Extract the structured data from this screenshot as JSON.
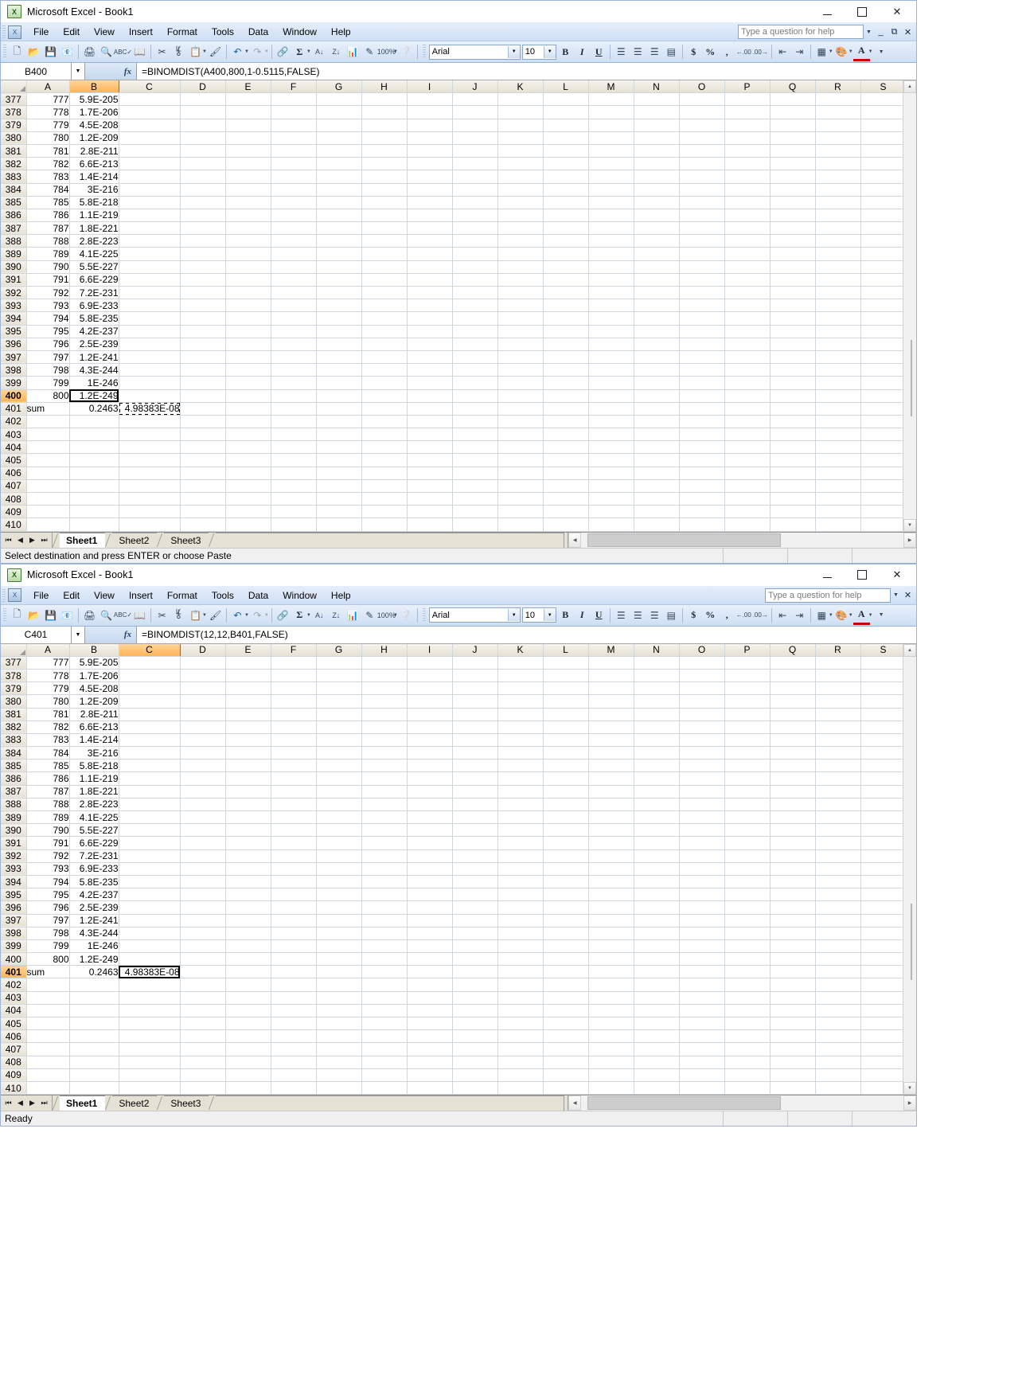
{
  "windows": [
    {
      "id": "top",
      "title": "Microsoft Excel - Book1",
      "help_placeholder": "Type a question for help",
      "namebox": "B400",
      "formula": "=BINOMDIST(A400,800,1-0.5115,FALSE)",
      "font_name": "Arial",
      "font_size": "10",
      "selected_column": "B",
      "selected_row": "400",
      "status": "Select destination and press ENTER or choose Paste",
      "active_tab": "Sheet1",
      "copy_marquee_cell": "C401"
    },
    {
      "id": "bottom",
      "title": "Microsoft Excel - Book1",
      "help_placeholder": "Type a question for help",
      "namebox": "C401",
      "formula": "=BINOMDIST(12,12,B401,FALSE)",
      "font_name": "Arial",
      "font_size": "10",
      "selected_column": "C",
      "selected_row": "401",
      "status": "Ready",
      "active_tab": "Sheet1",
      "copy_marquee_cell": ""
    }
  ],
  "menu": [
    {
      "label": "File",
      "accel": "F"
    },
    {
      "label": "Edit",
      "accel": "E"
    },
    {
      "label": "View",
      "accel": "V"
    },
    {
      "label": "Insert",
      "accel": "I"
    },
    {
      "label": "Format",
      "accel": "o"
    },
    {
      "label": "Tools",
      "accel": "T"
    },
    {
      "label": "Data",
      "accel": "D"
    },
    {
      "label": "Window",
      "accel": "W"
    },
    {
      "label": "Help",
      "accel": "H"
    }
  ],
  "toolbar_icons": [
    {
      "name": "new-icon",
      "glyph": "🗋"
    },
    {
      "name": "open-icon",
      "glyph": "📂"
    },
    {
      "name": "save-icon",
      "glyph": "💾"
    },
    {
      "name": "permission-icon",
      "glyph": "📧"
    },
    {
      "name": "print-icon",
      "glyph": "🖨"
    },
    {
      "name": "print-preview-icon",
      "glyph": "🔍"
    },
    {
      "name": "spelling-icon",
      "glyph": "ABC"
    },
    {
      "name": "research-icon",
      "glyph": "📖"
    },
    {
      "name": "cut-icon",
      "glyph": "✂"
    },
    {
      "name": "copy-icon",
      "glyph": "⧉"
    },
    {
      "name": "paste-icon",
      "glyph": "📋"
    },
    {
      "name": "format-painter-icon",
      "glyph": "🖌"
    },
    {
      "name": "undo-icon",
      "glyph": "↶"
    },
    {
      "name": "redo-icon",
      "glyph": "↷"
    },
    {
      "name": "hyperlink-icon",
      "glyph": "🔗"
    },
    {
      "name": "autosum-icon",
      "glyph": "Σ"
    },
    {
      "name": "sort-ascending-icon",
      "glyph": "A↓"
    },
    {
      "name": "sort-descending-icon",
      "glyph": "Z↓"
    },
    {
      "name": "chart-wizard-icon",
      "glyph": "📊"
    },
    {
      "name": "drawing-icon",
      "glyph": "✎"
    },
    {
      "name": "zoom-icon",
      "glyph": "⌕"
    },
    {
      "name": "help-icon",
      "glyph": "?"
    }
  ],
  "format_icons": [
    {
      "name": "bold-icon",
      "glyph": "B"
    },
    {
      "name": "italic-icon",
      "glyph": "I"
    },
    {
      "name": "underline-icon",
      "glyph": "U"
    },
    {
      "name": "align-left-icon",
      "glyph": "☰"
    },
    {
      "name": "align-center-icon",
      "glyph": "☰"
    },
    {
      "name": "align-right-icon",
      "glyph": "☰"
    },
    {
      "name": "merge-center-icon",
      "glyph": "▤"
    },
    {
      "name": "currency-icon",
      "glyph": "$"
    },
    {
      "name": "percent-icon",
      "glyph": "%"
    },
    {
      "name": "comma-icon",
      "glyph": ","
    },
    {
      "name": "increase-decimal-icon",
      "glyph": ".00"
    },
    {
      "name": "decrease-decimal-icon",
      "glyph": ".0"
    },
    {
      "name": "decrease-indent-icon",
      "glyph": "⇤"
    },
    {
      "name": "increase-indent-icon",
      "glyph": "⇥"
    },
    {
      "name": "borders-icon",
      "glyph": "▦"
    },
    {
      "name": "fill-color-icon",
      "glyph": "🪣"
    },
    {
      "name": "font-color-icon",
      "glyph": "A"
    }
  ],
  "sheet_tabs": [
    "Sheet1",
    "Sheet2",
    "Sheet3"
  ],
  "columns": [
    "A",
    "B",
    "C",
    "D",
    "E",
    "F",
    "G",
    "H",
    "I",
    "J",
    "K",
    "L",
    "M",
    "N",
    "O",
    "P",
    "Q",
    "R",
    "S"
  ],
  "rows": [
    {
      "r": "377",
      "a": "777",
      "b": "5.9E-205",
      "c": ""
    },
    {
      "r": "378",
      "a": "778",
      "b": "1.7E-206",
      "c": ""
    },
    {
      "r": "379",
      "a": "779",
      "b": "4.5E-208",
      "c": ""
    },
    {
      "r": "380",
      "a": "780",
      "b": "1.2E-209",
      "c": ""
    },
    {
      "r": "381",
      "a": "781",
      "b": "2.8E-211",
      "c": ""
    },
    {
      "r": "382",
      "a": "782",
      "b": "6.6E-213",
      "c": ""
    },
    {
      "r": "383",
      "a": "783",
      "b": "1.4E-214",
      "c": ""
    },
    {
      "r": "384",
      "a": "784",
      "b": "3E-216",
      "c": ""
    },
    {
      "r": "385",
      "a": "785",
      "b": "5.8E-218",
      "c": ""
    },
    {
      "r": "386",
      "a": "786",
      "b": "1.1E-219",
      "c": ""
    },
    {
      "r": "387",
      "a": "787",
      "b": "1.8E-221",
      "c": ""
    },
    {
      "r": "388",
      "a": "788",
      "b": "2.8E-223",
      "c": ""
    },
    {
      "r": "389",
      "a": "789",
      "b": "4.1E-225",
      "c": ""
    },
    {
      "r": "390",
      "a": "790",
      "b": "5.5E-227",
      "c": ""
    },
    {
      "r": "391",
      "a": "791",
      "b": "6.6E-229",
      "c": ""
    },
    {
      "r": "392",
      "a": "792",
      "b": "7.2E-231",
      "c": ""
    },
    {
      "r": "393",
      "a": "793",
      "b": "6.9E-233",
      "c": ""
    },
    {
      "r": "394",
      "a": "794",
      "b": "5.8E-235",
      "c": ""
    },
    {
      "r": "395",
      "a": "795",
      "b": "4.2E-237",
      "c": ""
    },
    {
      "r": "396",
      "a": "796",
      "b": "2.5E-239",
      "c": ""
    },
    {
      "r": "397",
      "a": "797",
      "b": "1.2E-241",
      "c": ""
    },
    {
      "r": "398",
      "a": "798",
      "b": "4.3E-244",
      "c": ""
    },
    {
      "r": "399",
      "a": "799",
      "b": "1E-246",
      "c": ""
    },
    {
      "r": "400",
      "a": "800",
      "b": "1.2E-249",
      "c": ""
    },
    {
      "r": "401",
      "a": "sum",
      "b": "0.2463",
      "c": "4.98383E-08"
    },
    {
      "r": "402",
      "a": "",
      "b": "",
      "c": ""
    },
    {
      "r": "403",
      "a": "",
      "b": "",
      "c": ""
    },
    {
      "r": "404",
      "a": "",
      "b": "",
      "c": ""
    },
    {
      "r": "405",
      "a": "",
      "b": "",
      "c": ""
    },
    {
      "r": "406",
      "a": "",
      "b": "",
      "c": ""
    },
    {
      "r": "407",
      "a": "",
      "b": "",
      "c": ""
    },
    {
      "r": "408",
      "a": "",
      "b": "",
      "c": ""
    },
    {
      "r": "409",
      "a": "",
      "b": "",
      "c": ""
    },
    {
      "r": "410",
      "a": "",
      "b": "",
      "c": ""
    }
  ],
  "colors": {
    "selected_header": "#ffb457",
    "titlebar_menu": "#cfdff4",
    "grid_line": "#d0d7de",
    "header_bg": "#e6e1d5"
  }
}
